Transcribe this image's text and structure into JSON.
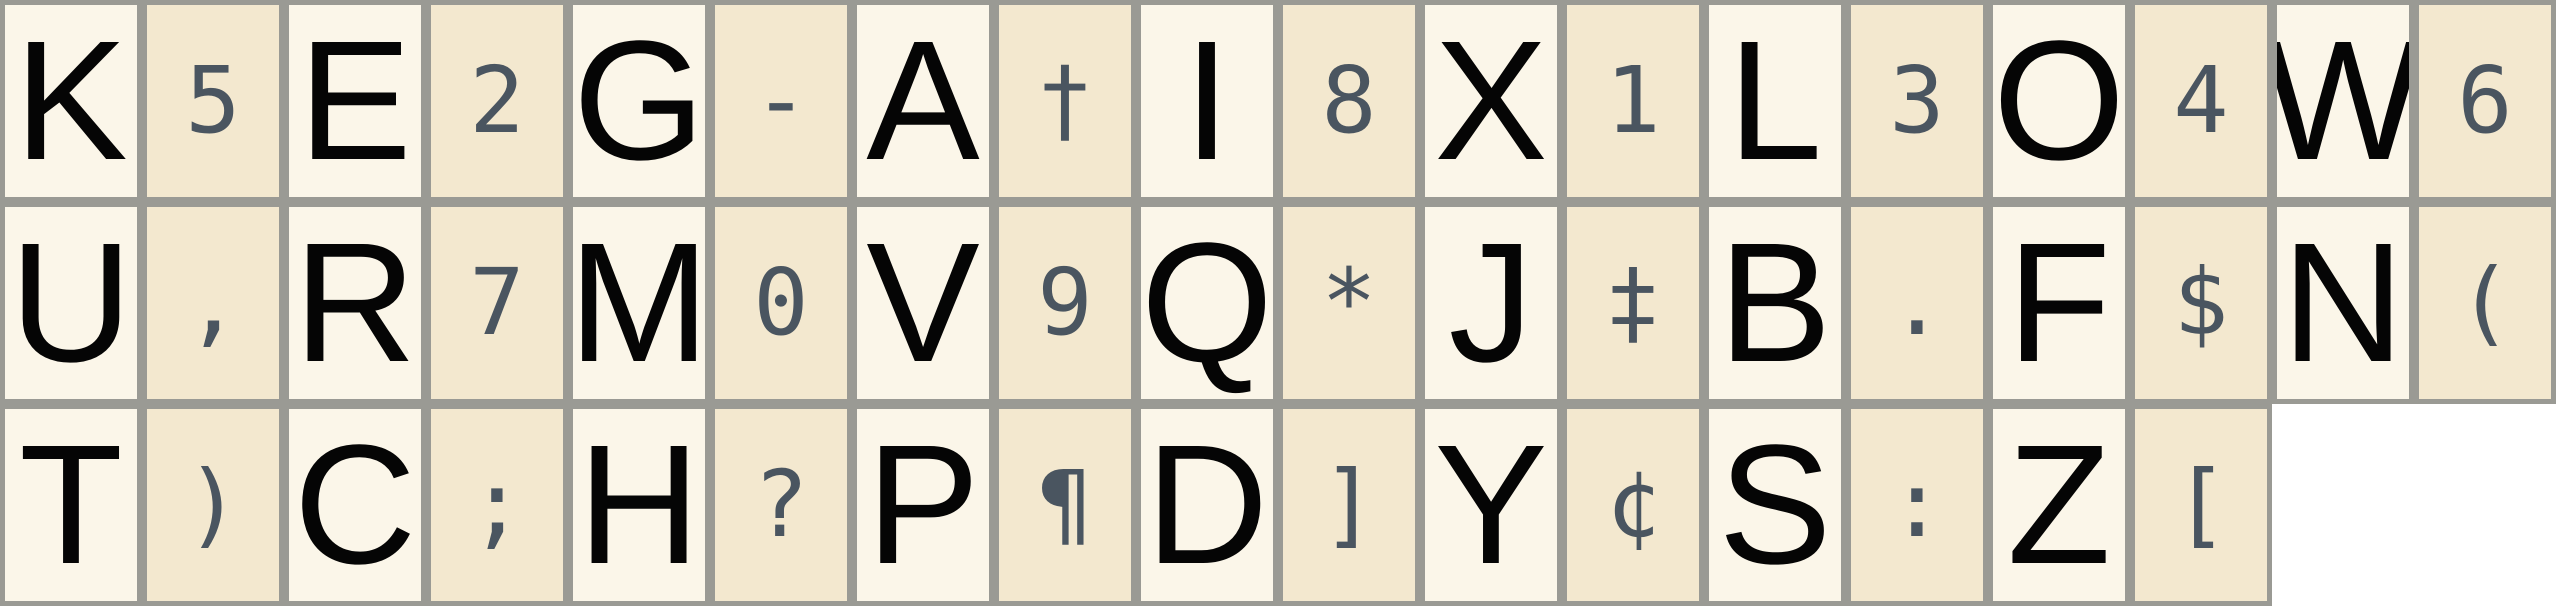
{
  "rows": [
    [
      "K",
      "5",
      "E",
      "2",
      "G",
      "-",
      "A",
      "†",
      "I",
      "8",
      "X",
      "1",
      "L",
      "3",
      "O",
      "4",
      "W",
      "6"
    ],
    [
      "U",
      ",",
      "R",
      "7",
      "M",
      "0",
      "V",
      "9",
      "Q",
      "*",
      "J",
      "‡",
      "B",
      ".",
      "F",
      "$",
      "N",
      "("
    ],
    [
      "T",
      ")",
      "C",
      ";",
      "H",
      "?",
      "P",
      "¶",
      "D",
      "]",
      "Y",
      "¢",
      "S",
      ":",
      "Z",
      "["
    ]
  ]
}
